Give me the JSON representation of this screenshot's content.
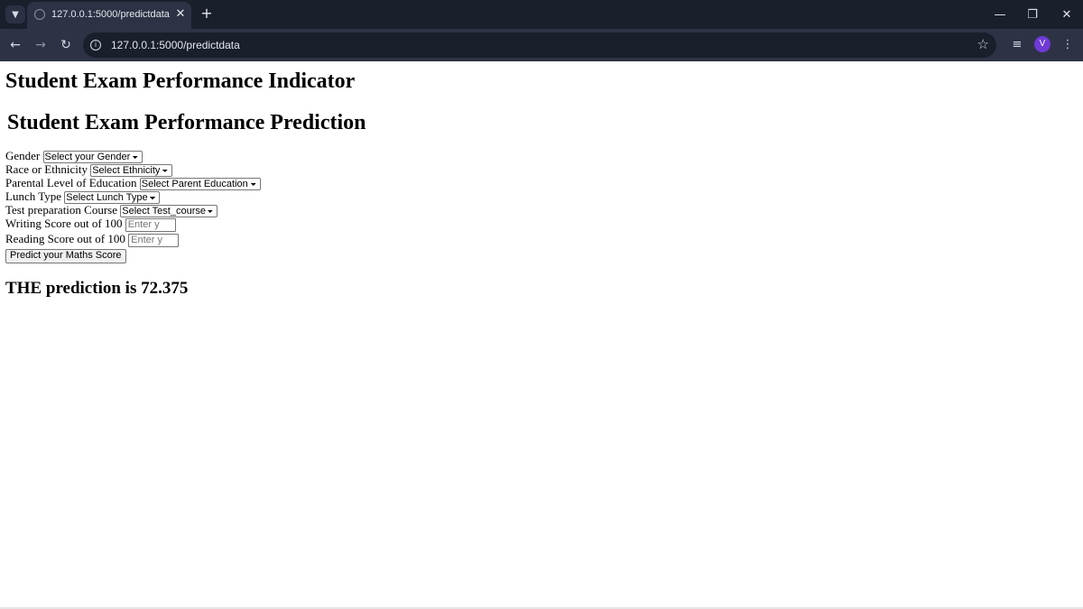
{
  "browser": {
    "tab_title": "127.0.0.1:5000/predictdata",
    "url": "127.0.0.1:5000/predictdata",
    "avatar_letter": "V",
    "colors": {
      "frame": "#1a1f2c",
      "toolbar": "#2d3345",
      "avatar": "#6f3ad6"
    }
  },
  "page": {
    "heading": "Student Exam Performance Indicator",
    "subheading": "Student Exam Performance Prediction",
    "form": {
      "gender_label": "Gender",
      "gender_selected": "Select your Gender",
      "ethnicity_label": "Race or Ethnicity",
      "ethnicity_selected": "Select Ethnicity",
      "parent_education_label": "Parental Level of Education",
      "parent_education_selected": "Select Parent Education",
      "lunch_label": "Lunch Type",
      "lunch_selected": "Select Lunch Type",
      "test_prep_label": "Test preparation Course",
      "test_prep_selected": "Select Test_course",
      "writing_label": "Writing Score out of 100",
      "writing_placeholder": "Enter yo",
      "reading_label": "Reading Score out of 100",
      "reading_placeholder": "Enter yo",
      "submit_label": "Predict your Maths Score"
    },
    "result": "THE prediction is 72.375"
  }
}
